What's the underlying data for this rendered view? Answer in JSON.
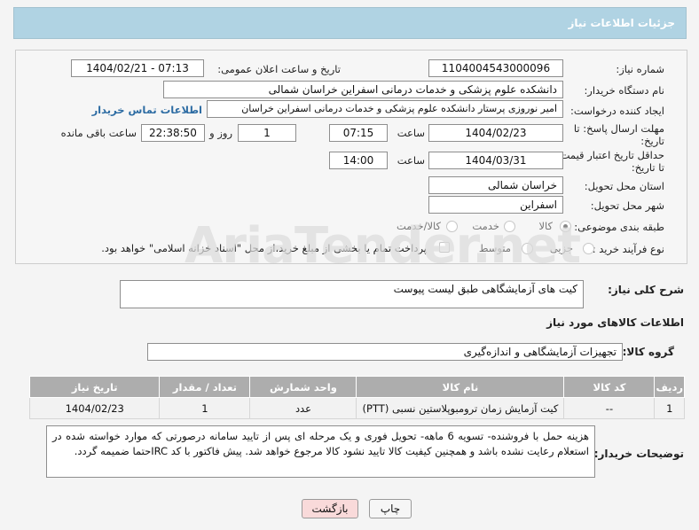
{
  "header": {
    "title": "جزئیات اطلاعات نیاز"
  },
  "form": {
    "need_number_label": "شماره نیاز:",
    "need_number": "1104004543000096",
    "announce_label": "تاریخ و ساعت اعلان عمومی:",
    "announce_value": "1404/02/21 - 07:13",
    "buyer_label": "نام دستگاه خریدار:",
    "buyer_value": "دانشکده علوم پزشکی و خدمات درمانی اسفراین خراسان شمالی",
    "creator_label": "ایجاد کننده درخواست:",
    "creator_value": "امیر  نوروزی  پرستار  دانشکده علوم پزشکی و خدمات درمانی اسفراین خراسان",
    "contact_link": "اطلاعات تماس خریدار",
    "deadline_label_1": "مهلت ارسال پاسخ: تا",
    "deadline_label_2": "تاریخ:",
    "deadline_date": "1404/02/23",
    "time_label": "ساعت",
    "deadline_time": "07:15",
    "days_value": "1",
    "days_label": "روز و",
    "remaining_time": "22:38:50",
    "remaining_label": "ساعت باقی مانده",
    "validity_label_1": "حداقل تاریخ اعتبار قیمت:",
    "validity_label_2": "تا تاریخ:",
    "validity_date": "1404/03/31",
    "validity_time": "14:00",
    "province_label": "استان محل تحویل:",
    "province_value": "خراسان شمالی",
    "city_label": "شهر محل تحویل:",
    "city_value": "اسفراین",
    "category_label": "طبقه بندی موضوعی:",
    "category_options": [
      "کالا",
      "خدمت",
      "کالا/خدمت"
    ],
    "category_selected": "کالا",
    "process_label": "نوع فرآیند خرید :",
    "process_options": [
      "جزیی",
      "متوسط"
    ],
    "process_note": "پرداخت تمام یا بخشی از مبلغ خرید،از محل \"اسناد خزانه اسلامی\" خواهد بود."
  },
  "description": {
    "label": "شرح کلی نیاز:",
    "value": "کیت های آزمایشگاهی طبق لیست پیوست"
  },
  "goods": {
    "section_title": "اطلاعات کالاهای مورد نیاز",
    "group_label": "گروه کالا:",
    "group_value": "تجهیزات آزمایشگاهی و اندازه‌گیری",
    "columns": [
      "ردیف",
      "کد کالا",
      "نام کالا",
      "واحد شمارش",
      "تعداد / مقدار",
      "تاریخ نیاز"
    ],
    "rows": [
      [
        "1",
        "--",
        "کیت آزمایش زمان ترومبوپلاستین نسبی (PTT)",
        "عدد",
        "1",
        "1404/02/23"
      ]
    ]
  },
  "buyer_notes": {
    "label": "توضیحات خریدار:",
    "value": "هزینه حمل با فروشنده- تسویه 6 ماهه- تحویل فوری و یک مرحله ای پس از تایید سامانه درصورتی که موارد خواسته شده در استعلام رعایت نشده باشد و همچنین کیفیت کالا تایید نشود کالا مرجوع خواهد شد. پیش فاکتور با کد IRCحتما ضمیمه گردد."
  },
  "buttons": {
    "print": "چاپ",
    "back": "بازگشت"
  },
  "watermark": "AriaTender.net",
  "colors": {
    "header_bg": "#b0d3e3",
    "table_header_bg": "#adadad",
    "back_button_bg": "#f9dada",
    "link": "#2d6ca3"
  }
}
